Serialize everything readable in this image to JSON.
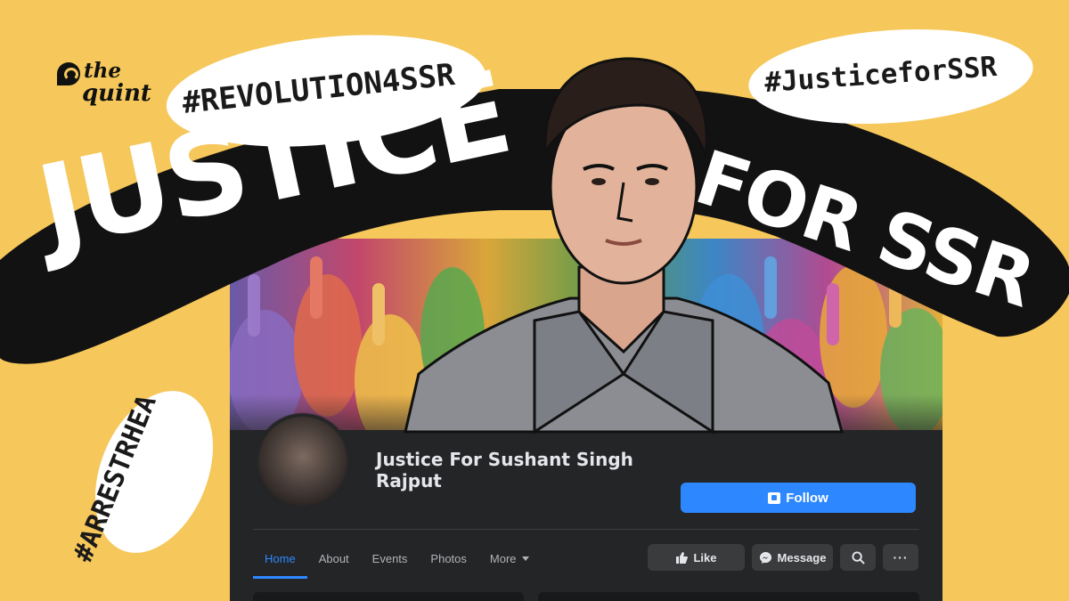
{
  "brand": {
    "the": "the",
    "quint": "quint"
  },
  "hashtags": {
    "revolution": "#REVOLUTION4SSR",
    "justice": "#JusticeforSSR",
    "arrest": "#ARRESTRHEA"
  },
  "headline": {
    "justice": "JUSTICE",
    "for_ssr": "FOR SSR"
  },
  "page": {
    "name": "Justice For Sushant Singh Rajput",
    "follow_label": "Follow"
  },
  "tabs": [
    {
      "label": "Home",
      "active": true
    },
    {
      "label": "About"
    },
    {
      "label": "Events"
    },
    {
      "label": "Photos"
    },
    {
      "label": "More"
    }
  ],
  "actions": {
    "like": "Like",
    "message": "Message",
    "more": "···"
  },
  "colors": {
    "background": "#f6c75a",
    "fb_dark": "#242526",
    "fb_blue": "#2d88ff",
    "ink": "#111111"
  },
  "icons": [
    "quint-logo-icon",
    "follow-icon",
    "like-icon",
    "messenger-icon",
    "search-icon",
    "more-icon",
    "caret-down-icon"
  ]
}
